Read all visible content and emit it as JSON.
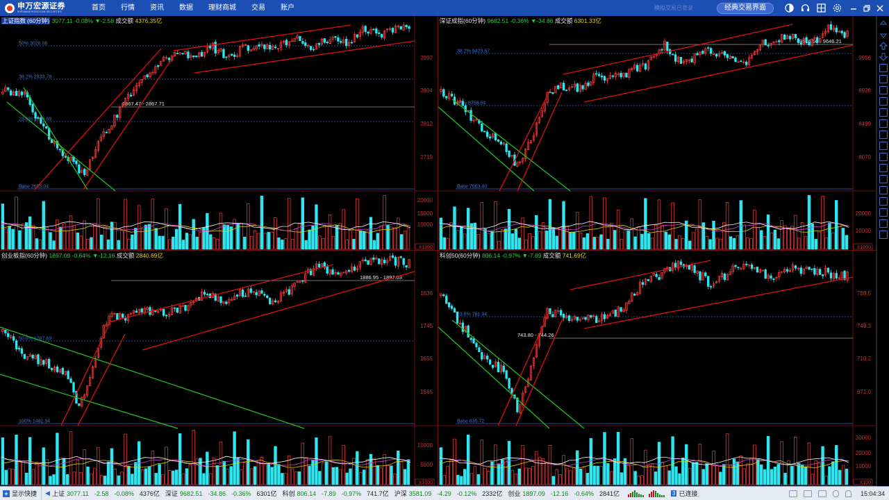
{
  "app": {
    "logo_cn": "申万宏源证券",
    "logo_en": "SHENWAN HONGYUAN SECURITIES",
    "nav": [
      "首页",
      "行情",
      "资讯",
      "数据",
      "理财商城",
      "交易",
      "账户"
    ],
    "hint": "模拟交易已登录",
    "classic_button": "经典交易界面",
    "toolbar_icons": [
      "theme-icon",
      "headset-icon",
      "grid-icon",
      "settings-icon",
      "minimize-icon",
      "restore-icon",
      "close-icon"
    ]
  },
  "panels": [
    {
      "id": "sh",
      "name": "上证指数",
      "period": "(60分钟)",
      "price": "3077.11",
      "pct": "-0.08%",
      "chg": "▼-2.58",
      "vol_label": "成交额",
      "vol": "4376.35亿",
      "y_labels": [
        "2997",
        "2904",
        "2812",
        "2719"
      ],
      "fib_labels": [
        "50% 3026.06",
        "38.2% 2933.78",
        "23.6% 2819.69",
        "Base 2655.04"
      ],
      "line_label": "2867.47 - 2867.71",
      "vol_y_labels": [
        "20000",
        "15000",
        "10000"
      ],
      "vol_unit": "X1000"
    },
    {
      "id": "sz",
      "name": "深证成指",
      "period": "(60分钟)",
      "price": "9682.51",
      "pct": "-0.36%",
      "chg": "▼-34.86",
      "vol_label": "成交额",
      "vol": "6301.33亿",
      "y_labels": [
        "9956",
        "8928",
        "8499",
        "8070"
      ],
      "fib_labels": [
        "38.2% 9423.67",
        "50% 8758.54",
        "Base 7663.40"
      ],
      "line_label": "9616.50 - 9646.21",
      "vol_y_labels": [
        "20000",
        "10000"
      ],
      "vol_unit": "X1000"
    },
    {
      "id": "cy",
      "name": "创业板指",
      "period": "(60分钟)",
      "price": "1897.09",
      "pct": "-0.64%",
      "chg": "▼-12.16",
      "vol_label": "成交额",
      "vol": "2840.69亿",
      "y_labels": [
        "1836",
        "1745",
        "1655",
        "1565"
      ],
      "fib_labels": [
        "50.0% 1707.69",
        "100% 1482.94"
      ],
      "line_label": "1886.95 - 1897.03",
      "vol_y_labels": [
        "10000",
        "5000"
      ],
      "vol_unit": "X1000"
    },
    {
      "id": "kc",
      "name": "科创50",
      "period": "(60分钟)",
      "price": "806.14",
      "pct": "-0.97%",
      "chg": "▼-7.89",
      "vol_label": "成交额",
      "vol": "741.69亿",
      "y_labels": [
        "788.5",
        "749.3",
        "710.2",
        "671.0"
      ],
      "fib_labels": [
        "23.6% 761.94",
        "Base 635.72"
      ],
      "line_label": "743.80 - 744.26",
      "vol_y_labels": [
        "30000",
        "20000",
        "10000"
      ],
      "vol_unit": "X100"
    }
  ],
  "status": {
    "quick": "显示快捷",
    "indices": [
      {
        "name": "上证",
        "price": "3077.11",
        "chg": "-2.58",
        "pct": "-0.08%",
        "vol": "4376亿"
      },
      {
        "name": "深证",
        "price": "9682.51",
        "chg": "-34.86",
        "pct": "-0.36%",
        "vol": "6301亿"
      },
      {
        "name": "科创",
        "price": "806.14",
        "chg": "-7.89",
        "pct": "-0.97%",
        "vol": "741.7亿"
      },
      {
        "name": "沪深",
        "price": "3581.09",
        "chg": "-4.29",
        "pct": "-0.12%",
        "vol": "2332亿"
      },
      {
        "name": "创业",
        "price": "1897.09",
        "chg": "-12.16",
        "pct": "-0.64%",
        "vol": "2841亿"
      }
    ],
    "conn_num": "3",
    "conn_text": "已连接",
    "time": "15:04:34"
  },
  "colors": {
    "up": "#ff3c3c",
    "down": "#2ee6f0",
    "channel_red": "#e01010",
    "channel_green": "#22c022",
    "fib_line": "#2a66d0",
    "axis_text": "#c83232"
  }
}
